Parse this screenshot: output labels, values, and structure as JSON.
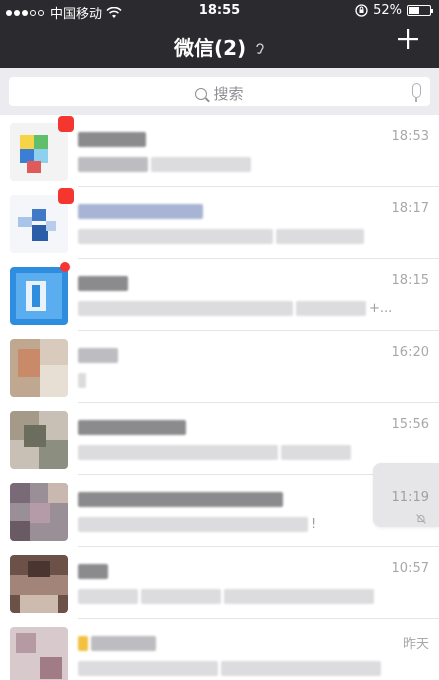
{
  "status_bar": {
    "carrier": "中国移动",
    "time": "18:55",
    "battery": "52%",
    "battery_level": 0.52
  },
  "nav": {
    "title": "微信(2)",
    "add_icon": "plus-icon",
    "ear_icon": "earpiece-icon"
  },
  "search": {
    "placeholder": "搜索",
    "icons": [
      "search-icon",
      "microphone-icon"
    ]
  },
  "colors": {
    "header_bg": "#2b2b2f",
    "search_bg": "#ebebf0",
    "badge": "#f43530"
  },
  "chats": [
    {
      "time": "18:53",
      "badge": true,
      "muted": false
    },
    {
      "time": "18:17",
      "badge": true,
      "muted": false
    },
    {
      "time": "18:15",
      "badge": true,
      "muted": false,
      "preview_suffix": "+..."
    },
    {
      "time": "16:20",
      "badge": false,
      "muted": false
    },
    {
      "time": "15:56",
      "badge": false,
      "muted": false
    },
    {
      "time": "11:19",
      "badge": false,
      "muted": true,
      "preview_suffix": "!"
    },
    {
      "time": "10:57",
      "badge": false,
      "muted": false
    },
    {
      "time": "昨天",
      "badge": false,
      "muted": false
    }
  ]
}
